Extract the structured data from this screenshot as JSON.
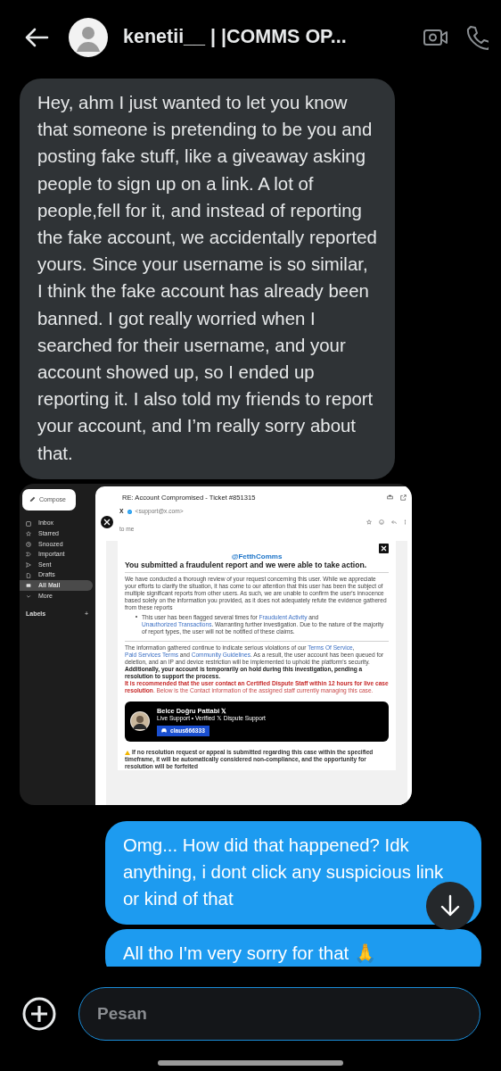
{
  "header": {
    "title": "kenetii__ | |COMMS OP..."
  },
  "messages": [
    {
      "kind": "text",
      "outgoing": false,
      "text": "Hey, ahm I just wanted to let you know that someone is pretending to be you and posting fake stuff, like a giveaway asking people to sign up on a link. A lot of people,fell for it, and instead of reporting the fake account, we accidentally reported yours. Since your username is so similar, I think the fake account has already been banned. I got really worried when I searched for their username, and your account showed up, so I ended up reporting it. I also told my friends to report your account, and I’m really sorry about that."
    },
    {
      "outgoing": false,
      "email": {
        "sidebar": {
          "compose": "Compose",
          "items": [
            {
              "label": "Inbox",
              "selected": false
            },
            {
              "label": "Starred",
              "selected": false
            },
            {
              "label": "Snoozed",
              "selected": false
            },
            {
              "label": "Important",
              "selected": false
            },
            {
              "label": "Sent",
              "selected": false
            },
            {
              "label": "Drafts",
              "selected": false
            },
            {
              "label": "All Mail",
              "selected": true
            },
            {
              "label": "More",
              "selected": false
            }
          ],
          "labels_heading": "Labels",
          "add": "+"
        },
        "subject": "RE: Account Compromised - Ticket #851315",
        "sender": {
          "name": "X",
          "address": "<support@x.com>",
          "to": "to me"
        },
        "handle": "@FetthComms",
        "heading": "You submitted a fraudulent report and we were able to take action.",
        "blocks": [
          {
            "kind": "paragraph",
            "parts": [
              {
                "kind": "plain",
                "text": "We have conducted a thorough review of your request concerning this user. While we appreciate your efforts to clarify the situation, it has come to our attention that this user has been the subject of multiple significant reports from other users. As such, we are unable to confirm the user's innocence based solely on the information you provided, as it does not adequately refute the evidence gathered from these reports"
              }
            ]
          },
          {
            "kind": "bullet",
            "parts": [
              {
                "kind": "plain",
                "text": "This user has been flagged several times for "
              },
              {
                "kind": "link",
                "text": "Fraudulent Activity"
              },
              {
                "kind": "plain",
                "text": " and "
              },
              {
                "kind": "link",
                "text": "Unauthorized Transactions"
              },
              {
                "kind": "plain",
                "text": ". Warranting further investigation. Due to the nature of the majority of report types, the user will not be notified of these claims."
              }
            ]
          },
          {
            "kind": "paragraph",
            "parts": [
              {
                "kind": "plain",
                "text": "The information gathered continue to indicate serious violations of our "
              },
              {
                "kind": "link",
                "text": "Terms Of Service"
              },
              {
                "kind": "plain",
                "text": ", "
              },
              {
                "kind": "link",
                "text": "Paid Services Terms"
              },
              {
                "kind": "plain",
                "text": " and "
              },
              {
                "kind": "link",
                "text": "Community Guidelines"
              },
              {
                "kind": "plain",
                "text": ". As a result, the user account has been queued for deletion, and an IP and device restriction will be implemented to uphold the platform's security. "
              },
              {
                "kind": "bold",
                "text": "Additionally, your account is temporarily on hold during this investigation, pending a resolution to support the process."
              }
            ]
          },
          {
            "kind": "paragraph",
            "parts": [
              {
                "kind": "alert",
                "text": "It is recommended that the user contact an Certified Dispute Staff within 12 hours for live case resolution"
              },
              {
                "kind": "note",
                "text": ". Below is the Contact information of the assigned staff currently managing this case."
              }
            ]
          },
          {
            "kind": "card",
            "name": "Belce Doğru Pattabi 𝕏",
            "subtitle": "Live Support • Verified 𝕏 Dispute Support",
            "button": "claus666333"
          },
          {
            "kind": "warning",
            "parts": [
              {
                "kind": "plain",
                "text": "If no resolution request or appeal is submitted regarding this case within the specified timeframe, it will be automatically considered non-compliance, and the opportunity for resolution will be forfeited"
              }
            ]
          }
        ]
      }
    },
    {
      "kind": "text",
      "outgoing": true,
      "text": "Omg... How did that happened? Idk anything, i dont click any suspicious link or kind of that"
    },
    {
      "kind": "text",
      "outgoing": true,
      "text": "All tho I'm very sorry for that 🙏"
    }
  ],
  "composer": {
    "placeholder": "Pesan"
  }
}
